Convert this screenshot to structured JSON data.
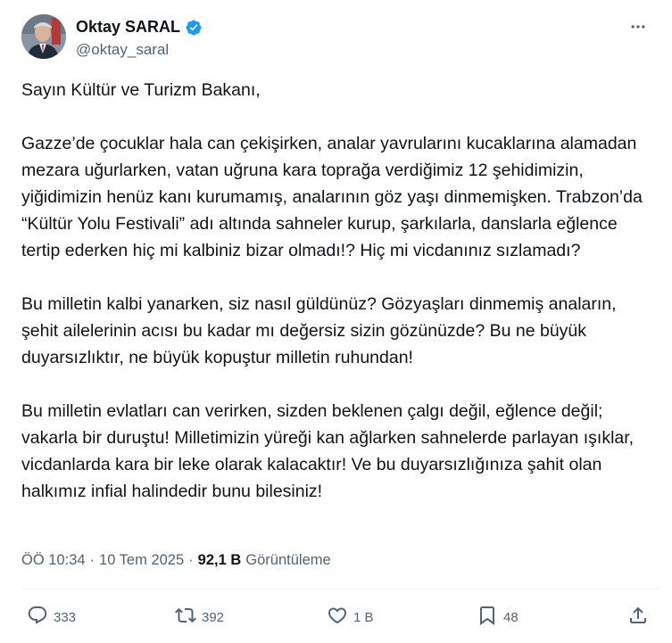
{
  "author": {
    "name": "Oktay SARAL",
    "handle": "@oktay_saral",
    "verified": true,
    "verified_color": "#1d9bf0"
  },
  "tweet": {
    "paragraphs": [
      "Sayın Kültür ve Turizm Bakanı,",
      "Gazze’de çocuklar hala can çekişirken, analar yavrularını kucaklarına alamadan mezara uğurlarken, vatan uğruna kara toprağa verdiğimiz 12 şehidimizin, yiğidimizin henüz kanı kurumamış, analarının göz yaşı dinmemişken. Trabzon’da “Kültür Yolu Festivali” adı altında sahneler kurup, şarkılarla, danslarla eğlence tertip ederken hiç mi kalbiniz bizar olmadı!? Hiç mi vicdanınız sızlamadı?",
      "Bu milletin kalbi yanarken, siz nasıl güldünüz? Gözyaşları dinmemiş anaların, şehit ailelerinin acısı bu kadar mı değersiz sizin gözünüzde? Bu ne büyük duyarsızlıktır, ne büyük kopuştur milletin ruhundan!",
      "Bu milletin evlatları can verirken, sizden beklenen çalgı değil, eğlence değil; vakarla bir duruştu! Milletimizin yüreği kan ağlarken sahnelerde parlayan ışıklar, vicdanlarda kara bir leke olarak kalacaktır! Ve bu duyarsızlığınıza şahit olan halkımız infial halindedir bunu bilesiniz!"
    ]
  },
  "meta": {
    "time": "ÖÖ 10:34",
    "separator": "·",
    "date": "10 Tem 2025",
    "views_count": "92,1 B",
    "views_label": "Görüntüleme"
  },
  "actions": {
    "replies": "333",
    "reposts": "392",
    "likes": "1 B",
    "bookmarks": "48"
  },
  "icons": [
    "verified-badge-icon",
    "more-icon",
    "reply-icon",
    "repost-icon",
    "like-icon",
    "bookmark-icon",
    "share-icon"
  ]
}
